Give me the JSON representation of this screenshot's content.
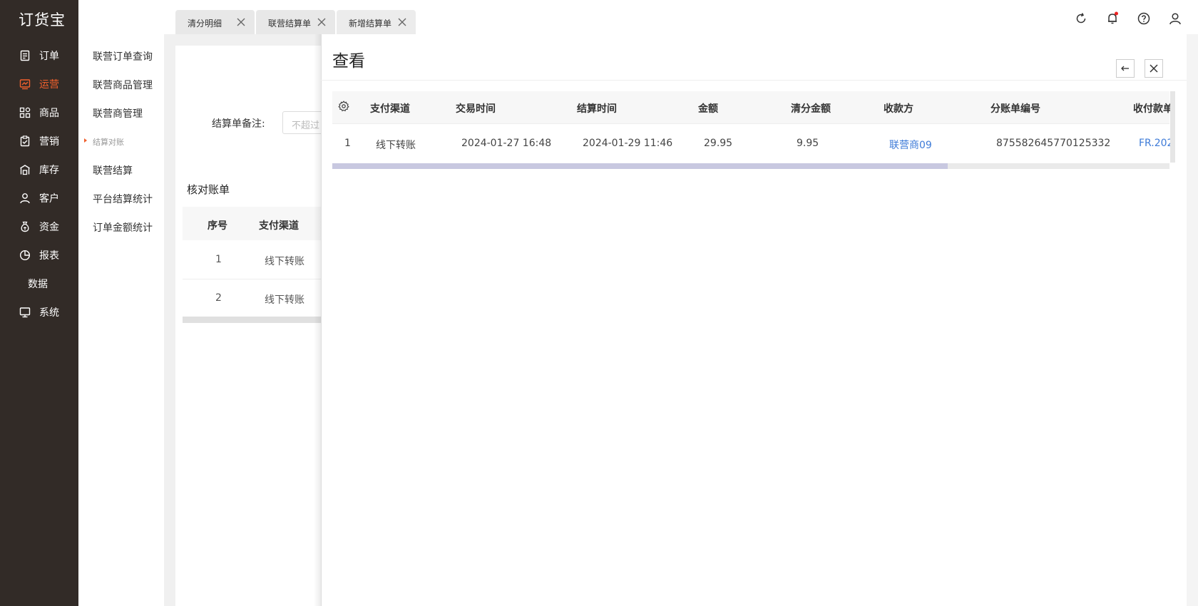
{
  "app": {
    "logo": "订货宝"
  },
  "nav": [
    {
      "label": "订单",
      "icon": "order-doc-icon",
      "active": false
    },
    {
      "label": "运营",
      "icon": "chart-trend-icon",
      "active": true
    },
    {
      "label": "商品",
      "icon": "grid-apps-icon",
      "active": false
    },
    {
      "label": "营销",
      "icon": "clipboard-check-icon",
      "active": false
    },
    {
      "label": "库存",
      "icon": "warehouse-icon",
      "active": false
    },
    {
      "label": "客户",
      "icon": "user-icon",
      "active": false
    },
    {
      "label": "资金",
      "icon": "money-bag-icon",
      "active": false
    },
    {
      "label": "报表",
      "icon": "pie-chart-icon",
      "active": false
    },
    {
      "label": "数据",
      "icon": "",
      "active": false
    },
    {
      "label": "系统",
      "icon": "monitor-icon",
      "active": false
    }
  ],
  "submenu": {
    "items": [
      "联营订单查询",
      "联营商品管理",
      "联营商管理"
    ],
    "group": "结算对账",
    "group_items": [
      "联营结算",
      "平台结算统计",
      "订单金额统计"
    ]
  },
  "tabs": [
    {
      "label": "清分明细"
    },
    {
      "label": "联营结算单"
    },
    {
      "label": "新增结算单"
    }
  ],
  "colors": {
    "accent": "#f0602d",
    "sidebar_bg": "#322b27",
    "link": "#3e7bd8"
  },
  "background_page": {
    "remark_label": "结算单备注:",
    "remark_placeholder": "不超过",
    "section_title": "核对账单",
    "table": {
      "headers": [
        "序号",
        "支付渠道"
      ],
      "rows": [
        [
          "1",
          "线下转账"
        ],
        [
          "2",
          "线下转账"
        ]
      ]
    }
  },
  "drawer": {
    "title": "查看",
    "back_icon": "arrow-left-icon",
    "close_icon": "close-icon",
    "table": {
      "settings_icon": "gear-icon",
      "headers": [
        "支付渠道",
        "交易时间",
        "结算时间",
        "金额",
        "清分金额",
        "收款方",
        "分账单编号",
        "收付款单"
      ],
      "rows": [
        [
          "1",
          "线下转账",
          "2024-01-27 16:48",
          "2024-01-29 11:46",
          "29.95",
          "9.95",
          "联营商09",
          "875582645770125332",
          "FR.202"
        ]
      ]
    }
  }
}
